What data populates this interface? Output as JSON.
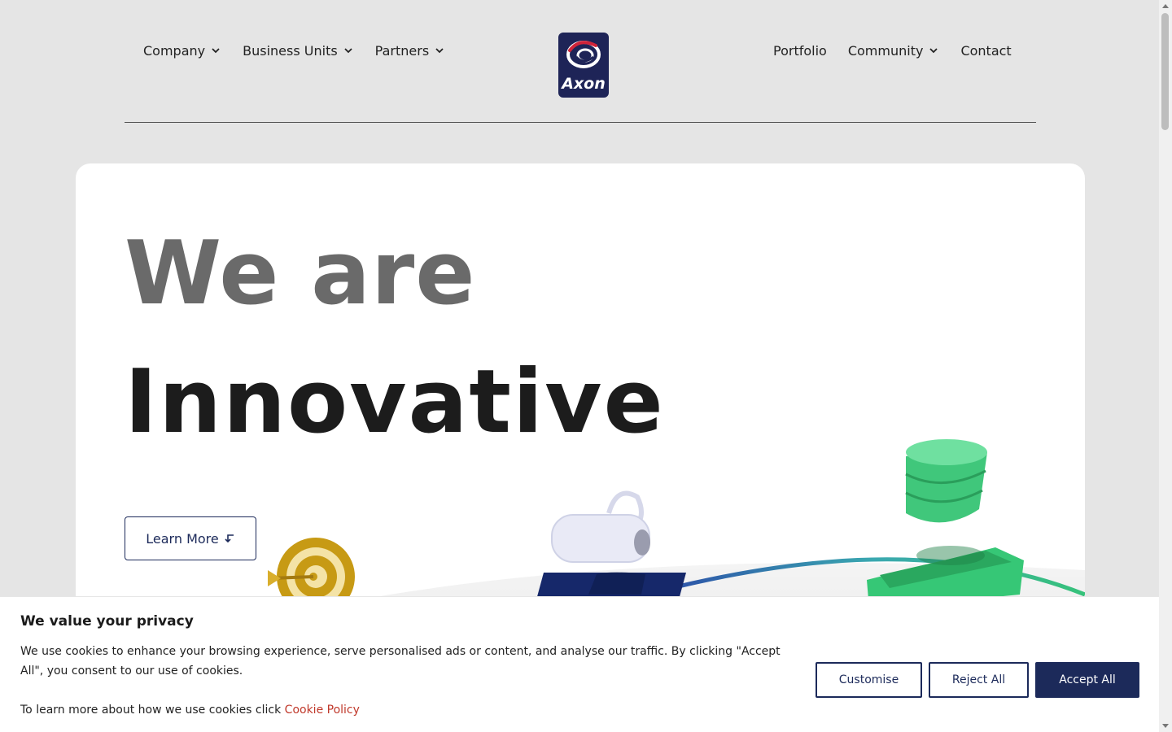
{
  "nav": {
    "left": [
      {
        "label": "Company",
        "has_dropdown": true
      },
      {
        "label": "Business Units",
        "has_dropdown": true
      },
      {
        "label": "Partners",
        "has_dropdown": true
      }
    ],
    "right": [
      {
        "label": "Portfolio",
        "has_dropdown": false
      },
      {
        "label": "Community",
        "has_dropdown": true
      },
      {
        "label": "Contact",
        "has_dropdown": false
      }
    ]
  },
  "logo": {
    "text": "Axon",
    "bg_color": "#1e2457"
  },
  "hero": {
    "line1": "We are",
    "line2": "Innovative",
    "cta_label": "Learn More"
  },
  "cookie": {
    "title": "We value your privacy",
    "text": "We use cookies to enhance your browsing experience, serve personalised ads or content, and analyse our traffic. By clicking \"Accept All\", you consent to our use of cookies.",
    "more_prefix": "To learn more about how we use cookies click",
    "policy_link": "Cookie Policy",
    "customise_label": "Customise",
    "reject_label": "Reject All",
    "accept_label": "Accept All"
  },
  "colors": {
    "brand_navy": "#1c2a5a",
    "page_bg": "#e5e5e5",
    "link_red": "#c0392b",
    "accent_green": "#3ccc7a"
  }
}
